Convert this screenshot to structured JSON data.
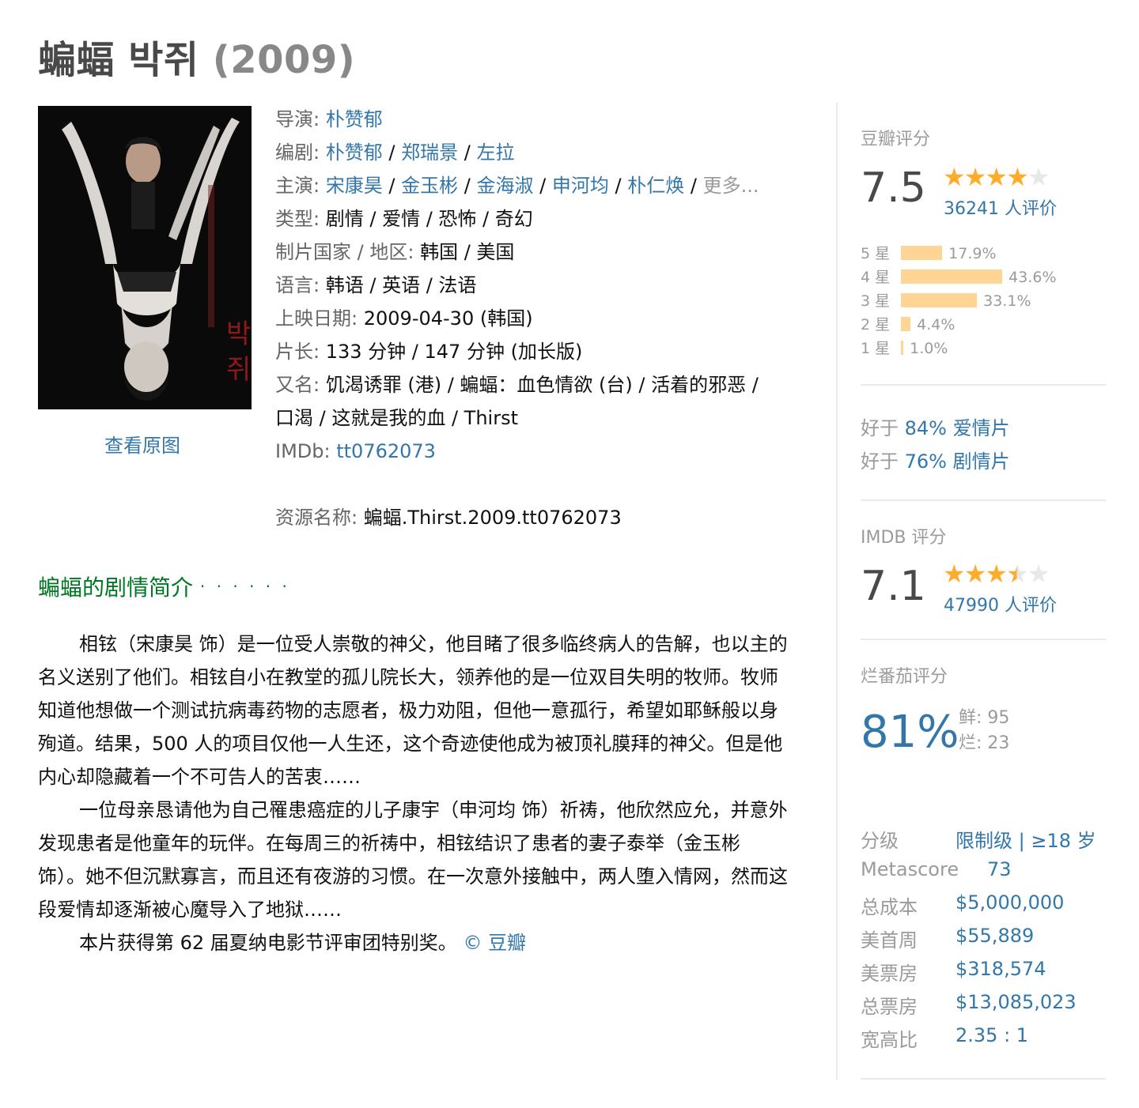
{
  "title": {
    "name": "蝙蝠 박쥐",
    "year": "(2009)"
  },
  "poster": {
    "view_original": "查看原图",
    "poster_title": "박쥐"
  },
  "info": {
    "director_label": "导演:",
    "director": [
      "朴赞郁"
    ],
    "writer_label": "编剧:",
    "writers": [
      "朴赞郁",
      "郑瑞景",
      "左拉"
    ],
    "cast_label": "主演:",
    "cast": [
      "宋康昊",
      "金玉彬",
      "金海淑",
      "申河均",
      "朴仁焕"
    ],
    "cast_more": "更多...",
    "genre_label": "类型:",
    "genre": "剧情 / 爱情 / 恐怖 / 奇幻",
    "country_label": "制片国家 / 地区:",
    "country": "韩国 / 美国",
    "language_label": "语言:",
    "language": "韩语 / 英语 / 法语",
    "release_label": "上映日期:",
    "release": "2009-04-30 (韩国)",
    "runtime_label": "片长:",
    "runtime": "133 分钟 / 147 分钟 (加长版)",
    "aka_label": "又名:",
    "aka_line1": "饥渴诱罪 (港) / 蝙蝠：血色情欲 (台) / 活着的邪恶 /",
    "aka_line2": "口渴 / 这就是我的血 / Thirst",
    "imdb_label": "IMDb:",
    "imdb_id": "tt0762073",
    "resource_label": "资源名称:",
    "resource": "蝙蝠.Thirst.2009.tt0762073"
  },
  "synopsis": {
    "heading": "蝙蝠的剧情简介",
    "dots": "· · · · · ·",
    "p1": "相铉（宋康昊 饰）是一位受人崇敬的神父，他目睹了很多临终病人的告解，也以主的名义送别了他们。相铉自小在教堂的孤儿院长大，领养他的是一位双目失明的牧师。牧师知道他想做一个测试抗病毒药物的志愿者，极力劝阻，但他一意孤行，希望如耶稣般以身殉道。结果，500 人的项目仅他一人生还，这个奇迹使他成为被顶礼膜拜的神父。但是他内心却隐藏着一个不可告人的苦衷……",
    "p2": "一位母亲恳请他为自己罹患癌症的儿子康宇（申河均 饰）祈祷，他欣然应允，并意外发现患者是他童年的玩伴。在每周三的祈祷中，相铉结识了患者的妻子泰举（金玉彬 饰）。她不但沉默寡言，而且还有夜游的习惯。在一次意外接触中，两人堕入情网，然而这段爱情却逐渐被心魔导入了地狱……",
    "p3": "本片获得第 62 届夏纳电影节评审团特别奖。",
    "credit": "© 豆瓣"
  },
  "douban": {
    "label": "豆瓣评分",
    "score": "7.5",
    "stars_value": 4,
    "votes": "36241 人评价",
    "dist": [
      {
        "label": "5 星",
        "pct": "17.9%",
        "value": 17.9
      },
      {
        "label": "4 星",
        "pct": "43.6%",
        "value": 43.6
      },
      {
        "label": "3 星",
        "pct": "33.1%",
        "value": 33.1
      },
      {
        "label": "2 星",
        "pct": "4.4%",
        "value": 4.4
      },
      {
        "label": "1 星",
        "pct": "1.0%",
        "value": 1.0
      }
    ],
    "better": [
      {
        "prefix": "好于",
        "value": "84% 爱情片"
      },
      {
        "prefix": "好于",
        "value": "76% 剧情片"
      }
    ]
  },
  "imdb_rating": {
    "label": "IMDB 评分",
    "score": "7.1",
    "stars_value": 3.5,
    "votes": "47990 人评价"
  },
  "tomato": {
    "label": "烂番茄评分",
    "score": "81%",
    "fresh_label": "鲜:",
    "fresh": "95",
    "rotten_label": "烂:",
    "rotten": "23"
  },
  "details": [
    {
      "key": "分级",
      "value": "限制级 | ≥18 岁"
    },
    {
      "key": "Metascore",
      "value": "73"
    },
    {
      "key": "总成本",
      "value": "$5,000,000"
    },
    {
      "key": "美首周",
      "value": "$55,889"
    },
    {
      "key": "美票房",
      "value": "$318,574"
    },
    {
      "key": "总票房",
      "value": "$13,085,023"
    },
    {
      "key": "宽高比",
      "value": "2.35 : 1"
    }
  ]
}
